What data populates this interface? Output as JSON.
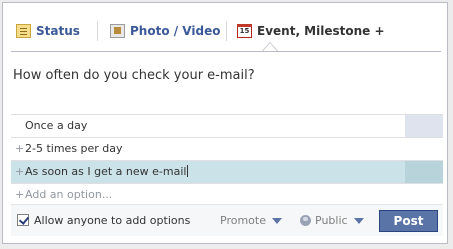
{
  "tabs": {
    "status": "Status",
    "photo": "Photo / Video",
    "event": "Event, Milestone +",
    "event_icon_number": "15"
  },
  "question": "How often do you check your e-mail?",
  "options": [
    "Once a day",
    "2-5 times per day",
    "As soon as I get a new e-mail"
  ],
  "add_option_placeholder": "Add an option...",
  "footer": {
    "allow_label": "Allow anyone to add options",
    "allow_checked": true,
    "promote": "Promote",
    "public": "Public",
    "post": "Post"
  },
  "colors": {
    "accent": "#3b5998",
    "post_button": "#5b74a8",
    "highlight": "#cbe3e8"
  }
}
